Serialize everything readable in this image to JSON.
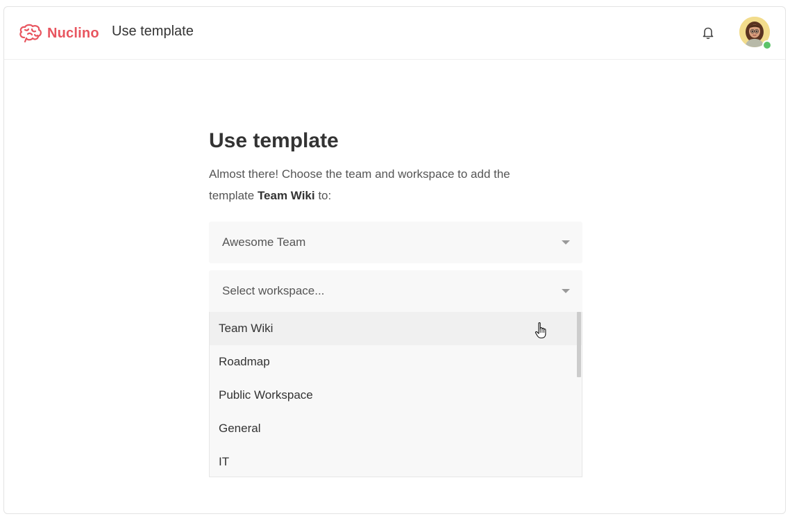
{
  "topbar": {
    "logo_text": "Nuclino",
    "title": "Use template",
    "icons": {
      "logo": "brain-logo-icon",
      "notifications": "bell-icon",
      "avatar": "user-avatar"
    }
  },
  "main": {
    "title": "Use template",
    "intro_prefix": "Almost there! Choose the team and workspace to add the template ",
    "template_name": "Team Wiki",
    "intro_suffix": " to:",
    "team_select": {
      "value": "Awesome Team"
    },
    "workspace_select": {
      "placeholder": "Select workspace...",
      "options": [
        "Team Wiki",
        "Roadmap",
        "Public Workspace",
        "General",
        "IT"
      ]
    }
  },
  "colors": {
    "brand": "#e8555f",
    "online": "#5cc36a",
    "field_bg": "#f8f8f8",
    "hover_bg": "#f0f0f0"
  }
}
